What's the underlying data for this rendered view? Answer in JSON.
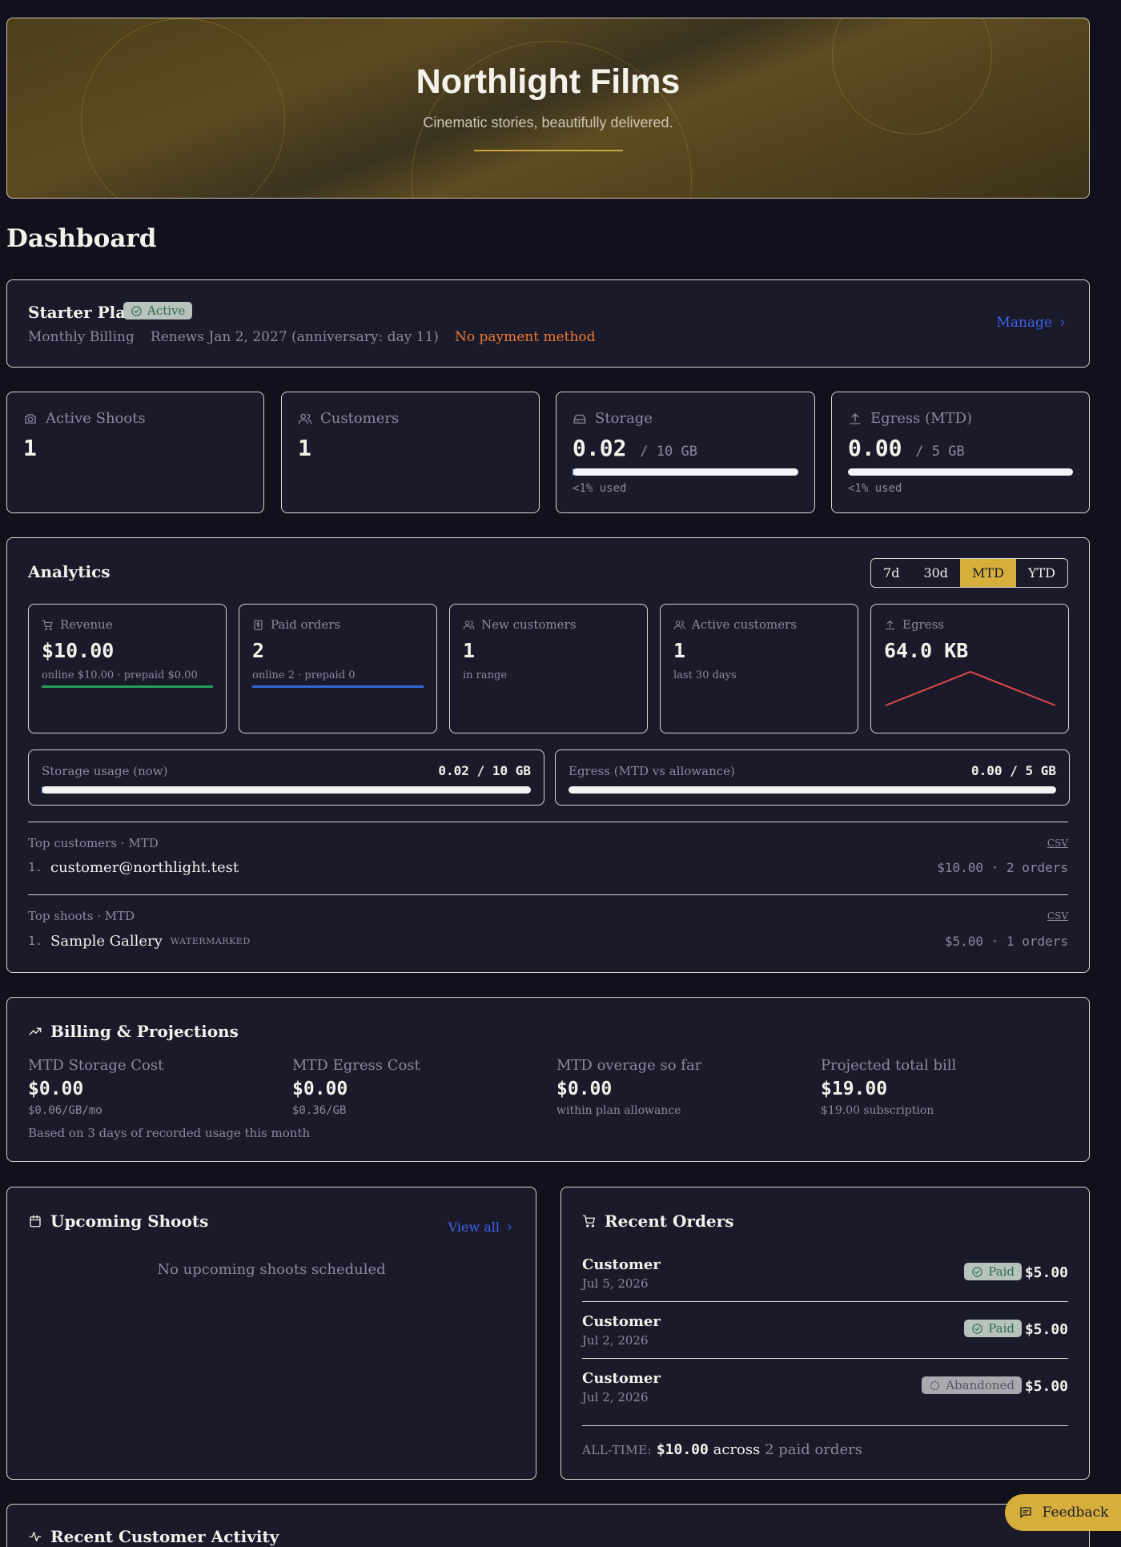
{
  "hero": {
    "title": "Northlight Films",
    "subtitle": "Cinematic stories, beautifully delivered."
  },
  "page": {
    "title": "Dashboard"
  },
  "plan": {
    "name": "Starter Plan",
    "status": "Active",
    "billing": "Monthly Billing",
    "renews": "Renews Jan 2, 2027 (anniversary: day 11)",
    "warning": "No payment method",
    "manage_label": "Manage"
  },
  "stats": {
    "active_shoots": {
      "label": "Active Shoots",
      "value": "1",
      "icon": "camera-icon"
    },
    "customers": {
      "label": "Customers",
      "value": "1",
      "icon": "users-icon"
    },
    "storage": {
      "label": "Storage",
      "value": "0.02",
      "unit": "/ 10 GB",
      "note": "<1% used",
      "fraction_used": 0.002,
      "icon": "hard-drive-icon"
    },
    "egress": {
      "label": "Egress (MTD)",
      "value": "0.00",
      "unit": "/ 5 GB",
      "note": "<1% used",
      "fraction_used": 0.0,
      "icon": "upload-icon"
    }
  },
  "analytics": {
    "title": "Analytics",
    "ranges": [
      "7d",
      "30d",
      "MTD",
      "YTD"
    ],
    "selected_range": "MTD",
    "cards": {
      "revenue": {
        "label": "Revenue",
        "value": "$10.00",
        "sub": "online $10.00 · prepaid $0.00",
        "accent": "#22a05a"
      },
      "paid_orders": {
        "label": "Paid orders",
        "value": "2",
        "sub": "online 2 · prepaid 0",
        "accent": "#2f66d8"
      },
      "new_customers": {
        "label": "New customers",
        "value": "1",
        "sub": "in range"
      },
      "active_customers": {
        "label": "Active customers",
        "value": "1",
        "sub": "last 30 days"
      },
      "egress": {
        "label": "Egress",
        "value": "64.0 KB",
        "accent": "#e04a4a",
        "spark": [
          0,
          1,
          0
        ]
      }
    },
    "storage_usage": {
      "label": "Storage usage (now)",
      "amount": "0.02 / 10 GB",
      "fraction_used": 0.002
    },
    "egress_usage": {
      "label": "Egress (MTD vs allowance)",
      "amount": "0.00 / 5 GB",
      "fraction_used": 0.0
    },
    "top_customers": {
      "header": "Top customers · MTD",
      "csv": "CSV",
      "rows": [
        {
          "num": "1.",
          "name": "customer@northlight.test",
          "right": "$10.00 · 2 orders"
        }
      ]
    },
    "top_shoots": {
      "header": "Top shoots · MTD",
      "csv": "CSV",
      "rows": [
        {
          "num": "1.",
          "name": "Sample Gallery",
          "tag": "WATERMARKED",
          "right": "$5.00 · 1 orders"
        }
      ]
    }
  },
  "billing": {
    "title": "Billing & Projections",
    "cols": [
      {
        "label": "MTD Storage Cost",
        "value": "$0.00",
        "sub": "$0.06/GB/mo"
      },
      {
        "label": "MTD Egress Cost",
        "value": "$0.00",
        "sub": "$0.36/GB"
      },
      {
        "label": "MTD overage so far",
        "value": "$0.00",
        "sub": "within plan allowance"
      },
      {
        "label": "Projected total bill",
        "value": "$19.00",
        "sub": "$19.00 subscription"
      }
    ],
    "note": "Based on 3 days of recorded usage this month"
  },
  "shoots": {
    "title": "Upcoming Shoots",
    "view_all": "View all",
    "empty": "No upcoming shoots scheduled"
  },
  "orders": {
    "title": "Recent Orders",
    "rows": [
      {
        "customer": "Customer",
        "date": "Jul 5, 2026",
        "status": "Paid",
        "amount": "$5.00"
      },
      {
        "customer": "Customer",
        "date": "Jul 2, 2026",
        "status": "Paid",
        "amount": "$5.00"
      },
      {
        "customer": "Customer",
        "date": "Jul 2, 2026",
        "status": "Abandoned",
        "amount": "$5.00"
      }
    ],
    "alltime_label": "ALL-TIME:",
    "alltime_amount": "$10.00",
    "alltime_across": "across",
    "alltime_count": "2 paid orders"
  },
  "activity": {
    "title": "Recent Customer Activity"
  },
  "feedback": {
    "label": "Feedback"
  },
  "colors": {
    "accent_gold": "#d5ae3c",
    "link_blue": "#3d63e8",
    "warning_orange": "#f07a30",
    "paid_green": "#2c6a4e"
  }
}
